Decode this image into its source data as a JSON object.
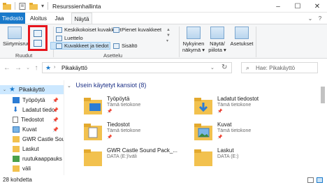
{
  "window": {
    "title": "Resurssienhallinta",
    "minimize_icon": "–",
    "maximize_icon": "☐",
    "close_icon": "✕"
  },
  "tabs": [
    {
      "label": "Tiedosto"
    },
    {
      "label": "Aloitus"
    },
    {
      "label": "Jaa"
    },
    {
      "label": "Näytä"
    }
  ],
  "ribbon": {
    "navigation_pane": "Siirtymisruutu",
    "panes_group": "Ruudut",
    "layout_items": [
      "Keskikokoiset kuvakkeet",
      "Luettelo",
      "Kuvakkeet ja tiedot",
      "Pienet kuvakkeet",
      "Sisältö"
    ],
    "layout_group": "Asettelu",
    "current_view": [
      "Nykyinen",
      "näkymä ▾"
    ],
    "show_hide": [
      "Näytä/",
      "piilota ▾"
    ],
    "options": "Asetukset"
  },
  "address": {
    "path": "Pikakäyttö",
    "search_placeholder": "Hae: Pikakäyttö"
  },
  "nav": [
    {
      "label": "Pikakäyttö",
      "pinned": false
    },
    {
      "label": "Työpöytä",
      "pinned": true
    },
    {
      "label": "Ladatut tiedo",
      "pinned": true
    },
    {
      "label": "Tiedostot",
      "pinned": true
    },
    {
      "label": "Kuvat",
      "pinned": true
    },
    {
      "label": "GWR Castle Soun",
      "pinned": false
    },
    {
      "label": "Laskut",
      "pinned": false
    },
    {
      "label": "ruutukaappauks",
      "pinned": false
    },
    {
      "label": "väli",
      "pinned": false
    }
  ],
  "content": {
    "section_title": "Usein käytetyt kansiot (8)",
    "pin_glyph": "📌",
    "folders": [
      {
        "name": "Työpöytä",
        "sub": "Tämä tietokone"
      },
      {
        "name": "Ladatut tiedostot",
        "sub": "Tämä tietokone"
      },
      {
        "name": "Tiedostot",
        "sub": "Tämä tietokone"
      },
      {
        "name": "Kuvat",
        "sub": "Tämä tietokone"
      },
      {
        "name": "GWR Castle Sound Pack_...",
        "sub": "DATA (E:)\\väli"
      },
      {
        "name": "Laskut",
        "sub": "DATA (E:)"
      }
    ]
  },
  "status": {
    "count": "28 kohdetta"
  },
  "colors": {
    "accent": "#1979ca",
    "highlight": "#e6141c",
    "folder": "#f2c14e",
    "selection": "#cce8ff"
  }
}
